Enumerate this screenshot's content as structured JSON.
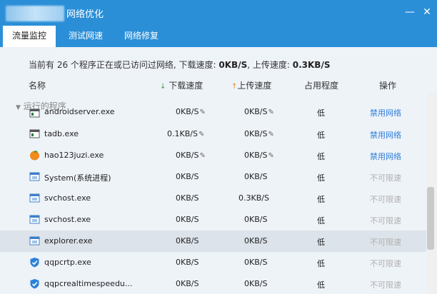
{
  "window": {
    "title": "网络优化",
    "minimize": "—",
    "close": "✕"
  },
  "tabs": [
    {
      "label": "流量监控",
      "active": true
    },
    {
      "label": "测试网速",
      "active": false
    },
    {
      "label": "网络修复",
      "active": false
    }
  ],
  "summary": {
    "prefix": "当前有 26 个程序正在或已访问过网络, 下载速度:",
    "download": "0KB/S",
    "mid": ", 上传速度:",
    "upload": "0.3KB/S"
  },
  "columns": {
    "name": "名称",
    "download": "下载速度",
    "upload": "上传速度",
    "usage": "占用程度",
    "action": "操作"
  },
  "group_label": "运行的程序",
  "rows": [
    {
      "name": "androidserver.exe",
      "down": "0KB/S",
      "up": "0KB/S",
      "usage": "低",
      "action": "禁用网络",
      "editable": true,
      "icon": "app-window-icon"
    },
    {
      "name": "tadb.exe",
      "down": "0.1KB/S",
      "up": "0KB/S",
      "usage": "低",
      "action": "禁用网络",
      "editable": true,
      "icon": "app-window-icon"
    },
    {
      "name": "hao123juzi.exe",
      "down": "0KB/S",
      "up": "0KB/S",
      "usage": "低",
      "action": "禁用网络",
      "editable": true,
      "icon": "orange-icon"
    },
    {
      "name": "System(系统进程)",
      "down": "0KB/S",
      "up": "0KB/S",
      "usage": "低",
      "action": "不可限速",
      "editable": false,
      "icon": "system-window-icon"
    },
    {
      "name": "svchost.exe",
      "down": "0KB/S",
      "up": "0.3KB/S",
      "usage": "低",
      "action": "不可限速",
      "editable": false,
      "icon": "system-window-icon"
    },
    {
      "name": "svchost.exe",
      "down": "0KB/S",
      "up": "0KB/S",
      "usage": "低",
      "action": "不可限速",
      "editable": false,
      "icon": "system-window-icon"
    },
    {
      "name": "explorer.exe",
      "down": "0KB/S",
      "up": "0KB/S",
      "usage": "低",
      "action": "不可限速",
      "editable": false,
      "icon": "system-window-icon"
    },
    {
      "name": "qqpcrtp.exe",
      "down": "0KB/S",
      "up": "0KB/S",
      "usage": "低",
      "action": "不可限速",
      "editable": false,
      "icon": "shield-icon"
    },
    {
      "name": "qqpcrealtimespeedu...",
      "down": "0KB/S",
      "up": "0KB/S",
      "usage": "低",
      "action": "不可限速",
      "editable": false,
      "icon": "shield-icon"
    }
  ],
  "colors": {
    "titlebar": "#2b8fd8",
    "link": "#2f7ed8",
    "disabled": "#b0b0b0",
    "selected_row": "#dde3ea"
  }
}
